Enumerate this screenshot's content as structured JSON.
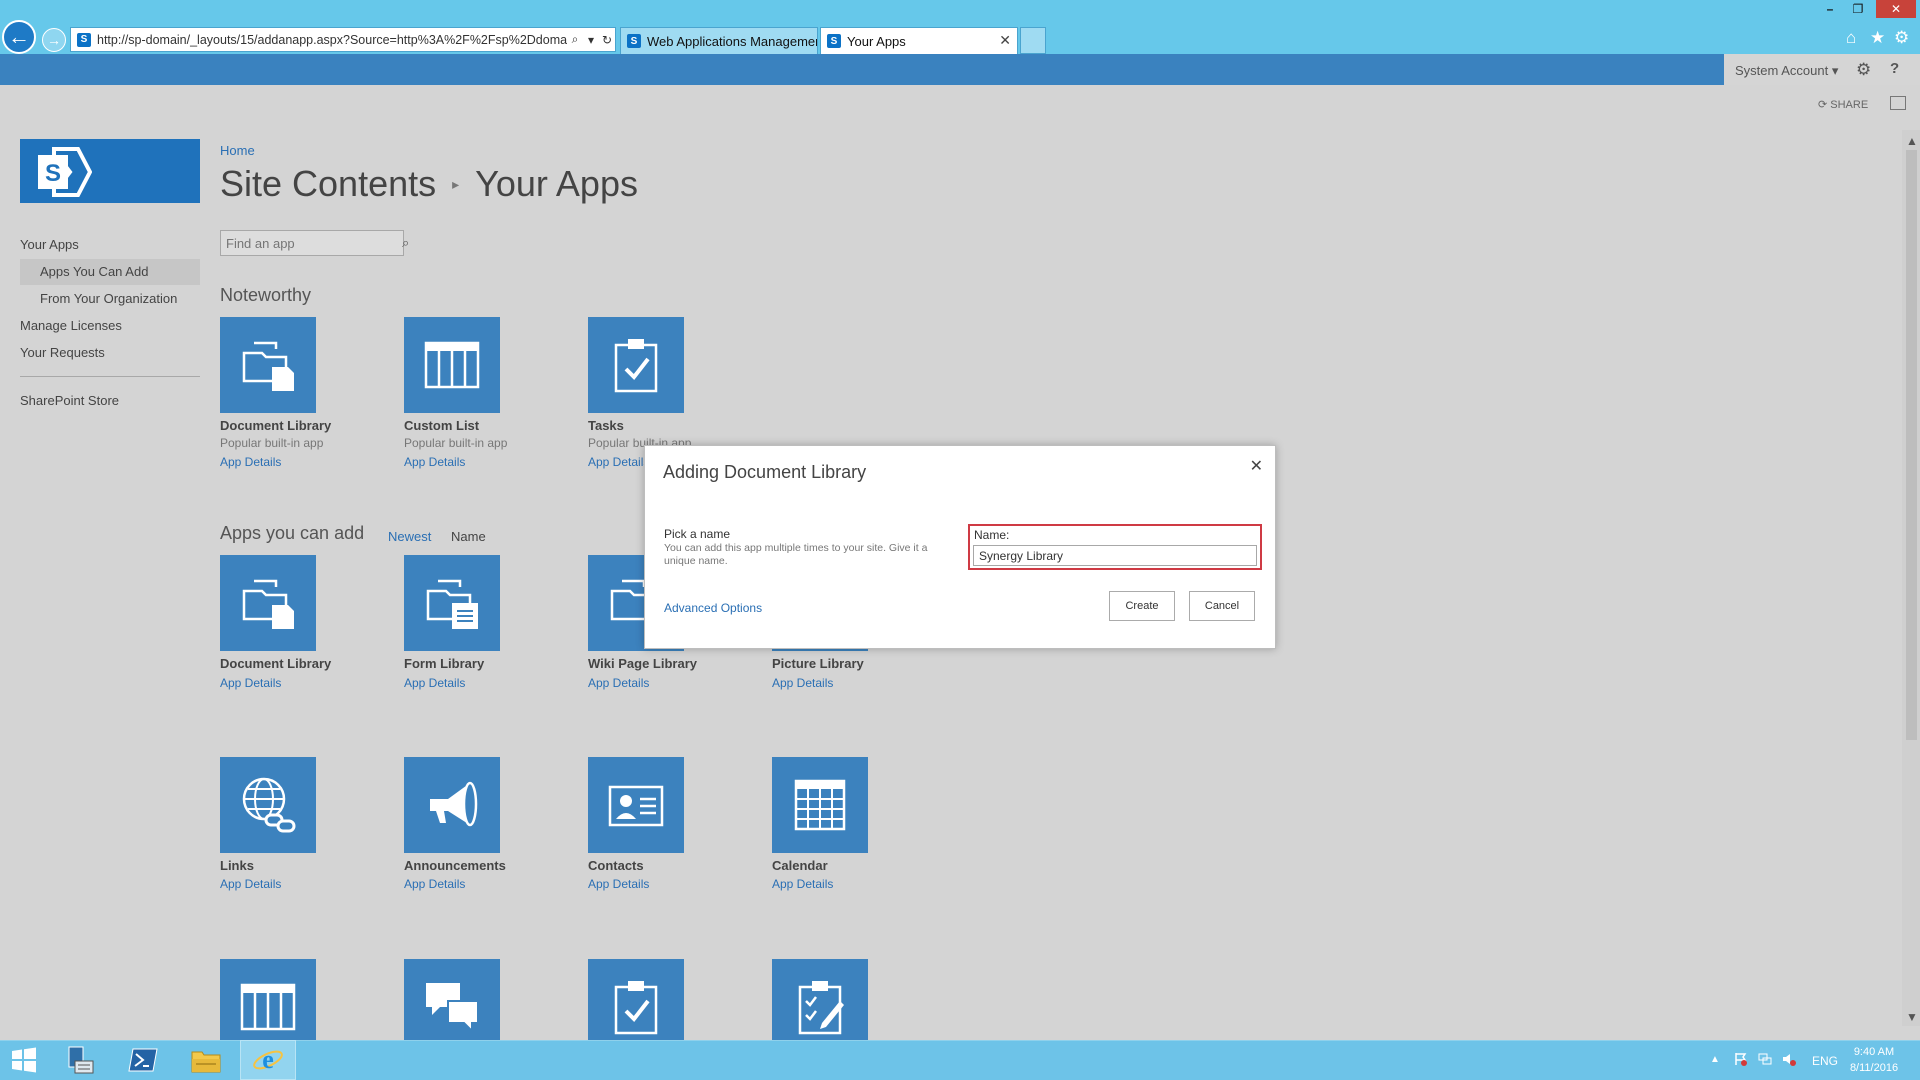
{
  "browser": {
    "address": "http://sp-domain/_layouts/15/addanapp.aspx?Source=http%3A%2F%2Fsp%2Ddomain%",
    "tabs": [
      {
        "label": "Web Applications Management"
      },
      {
        "label": "Your Apps"
      }
    ]
  },
  "suite": {
    "user": "System Account ▾",
    "share": "SHARE"
  },
  "sidebar": {
    "items": [
      {
        "label": "Your Apps"
      },
      {
        "label": "Apps You Can Add"
      },
      {
        "label": "From Your Organization"
      },
      {
        "label": "Manage Licenses"
      },
      {
        "label": "Your Requests"
      },
      {
        "label": "SharePoint Store"
      }
    ]
  },
  "header": {
    "breadcrumb": "Home",
    "title_parent": "Site Contents",
    "title_separator": "▸",
    "title_current": "Your Apps"
  },
  "search": {
    "placeholder": "Find an app"
  },
  "noteworthy": {
    "heading": "Noteworthy",
    "apps": [
      {
        "name": "Document Library",
        "sub": "Popular built-in app",
        "details": "App Details"
      },
      {
        "name": "Custom List",
        "sub": "Popular built-in app",
        "details": "App Details"
      },
      {
        "name": "Tasks",
        "sub": "Popular built-in app",
        "details": "App Details"
      }
    ]
  },
  "apps_add": {
    "heading": "Apps you can add",
    "sort_newest": "Newest",
    "sort_name": "Name",
    "apps": [
      {
        "name": "Document Library",
        "details": "App Details"
      },
      {
        "name": "Form Library",
        "details": "App Details"
      },
      {
        "name": "Wiki Page Library",
        "details": "App Details"
      },
      {
        "name": "Picture Library",
        "details": "App Details"
      },
      {
        "name": "Links",
        "details": "App Details"
      },
      {
        "name": "Announcements",
        "details": "App Details"
      },
      {
        "name": "Contacts",
        "details": "App Details"
      },
      {
        "name": "Calendar",
        "details": "App Details"
      }
    ]
  },
  "dialog": {
    "title": "Adding Document Library",
    "pick_label": "Pick a name",
    "pick_help": "You can add this app multiple times to your site. Give it a unique name.",
    "name_label": "Name:",
    "name_value": "Synergy Library",
    "advanced": "Advanced Options",
    "create": "Create",
    "cancel": "Cancel"
  },
  "taskbar": {
    "lang": "ENG",
    "time": "9:40 AM",
    "date": "8/11/2016"
  },
  "colors": {
    "tile": "#3c82be",
    "suitebar": "#3a82bf",
    "link": "#2a6fb4",
    "highlight_border": "#cf3a44"
  }
}
